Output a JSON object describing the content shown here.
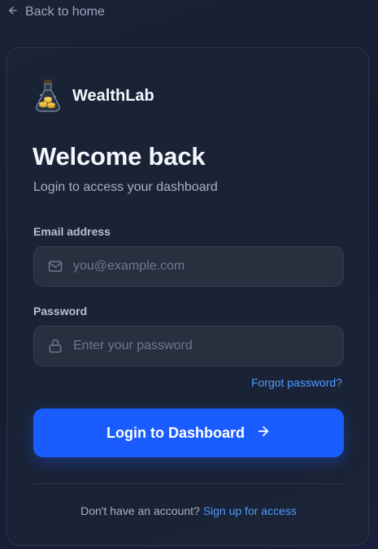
{
  "back_link": {
    "label": "Back to home",
    "icon": "arrow-left-icon"
  },
  "brand": {
    "name": "WealthLab",
    "logo_icon": "flask-coins-logo"
  },
  "header": {
    "title": "Welcome back",
    "subtitle": "Login to access your dashboard"
  },
  "form": {
    "email": {
      "label": "Email address",
      "placeholder": "you@example.com",
      "value": "",
      "icon": "mail-icon"
    },
    "password": {
      "label": "Password",
      "placeholder": "Enter your password",
      "value": "",
      "icon": "lock-icon"
    },
    "forgot_label": "Forgot password?",
    "submit_label": "Login to Dashboard",
    "submit_icon": "arrow-right-icon"
  },
  "footer": {
    "prompt": "Don't have an account?",
    "signup_label": "Sign up for access"
  },
  "colors": {
    "accent": "#1b5cff",
    "link": "#4f9bff",
    "card": "#1b2436"
  }
}
